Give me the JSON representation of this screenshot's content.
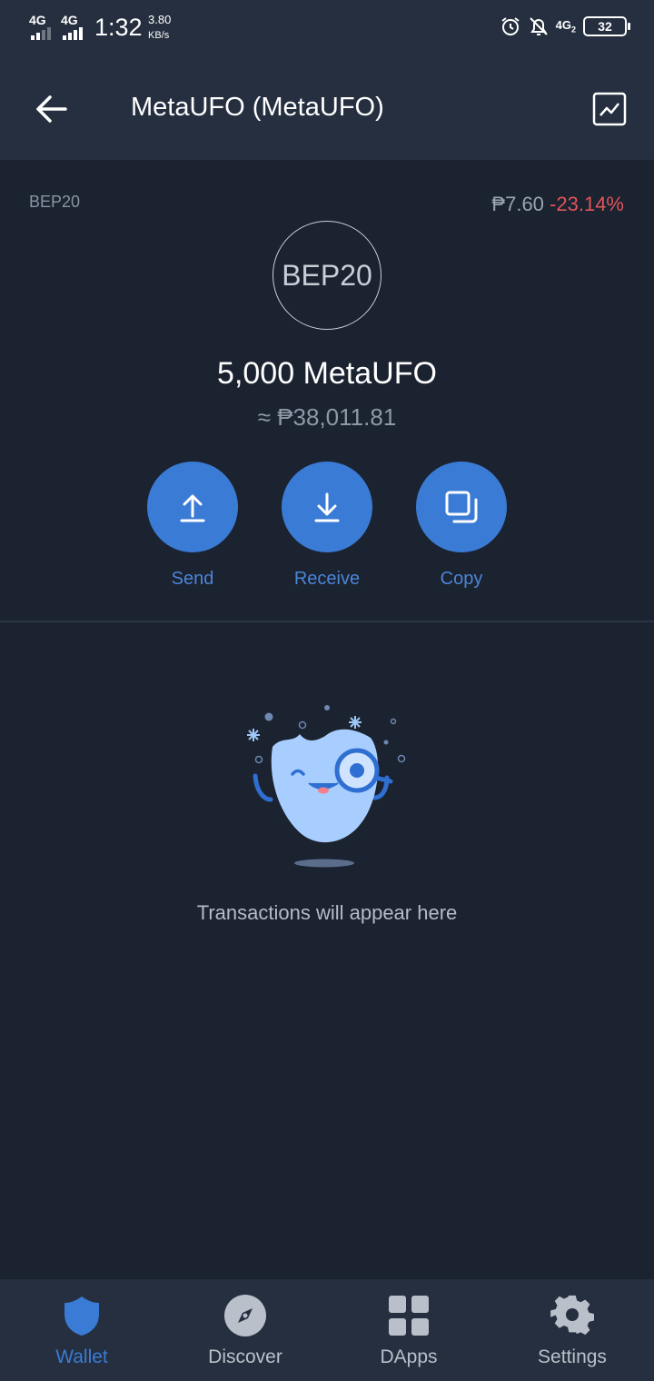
{
  "status_bar": {
    "network1": "4G",
    "network2": "4G",
    "time": "1:32",
    "speed_value": "3.80",
    "speed_unit": "KB/s",
    "network3": "4G",
    "network3_sub": "2",
    "battery": "32"
  },
  "header": {
    "title": "MetaUFO (MetaUFO)",
    "back_icon": "arrow-left-icon",
    "chart_icon": "chart-line-icon"
  },
  "token": {
    "network": "BEP20",
    "price": "₱7.60",
    "change": "-23.14%",
    "logo_text": "BEP20",
    "balance": "5,000 MetaUFO",
    "fiat_value": "≈ ₱38,011.81"
  },
  "actions": [
    {
      "label": "Send",
      "icon": "arrow-up-icon"
    },
    {
      "label": "Receive",
      "icon": "arrow-down-icon"
    },
    {
      "label": "Copy",
      "icon": "copy-icon"
    }
  ],
  "empty_state": {
    "illustration": "searching-mascot",
    "message": "Transactions will appear here"
  },
  "bottom_nav": [
    {
      "label": "Wallet",
      "icon": "shield-icon",
      "active": true
    },
    {
      "label": "Discover",
      "icon": "compass-icon",
      "active": false
    },
    {
      "label": "DApps",
      "icon": "grid-icon",
      "active": false
    },
    {
      "label": "Settings",
      "icon": "gear-icon",
      "active": false
    }
  ],
  "colors": {
    "background": "#1b2230",
    "header": "#252f3f",
    "accent": "#3a7bd5",
    "negative": "#e0555a"
  }
}
